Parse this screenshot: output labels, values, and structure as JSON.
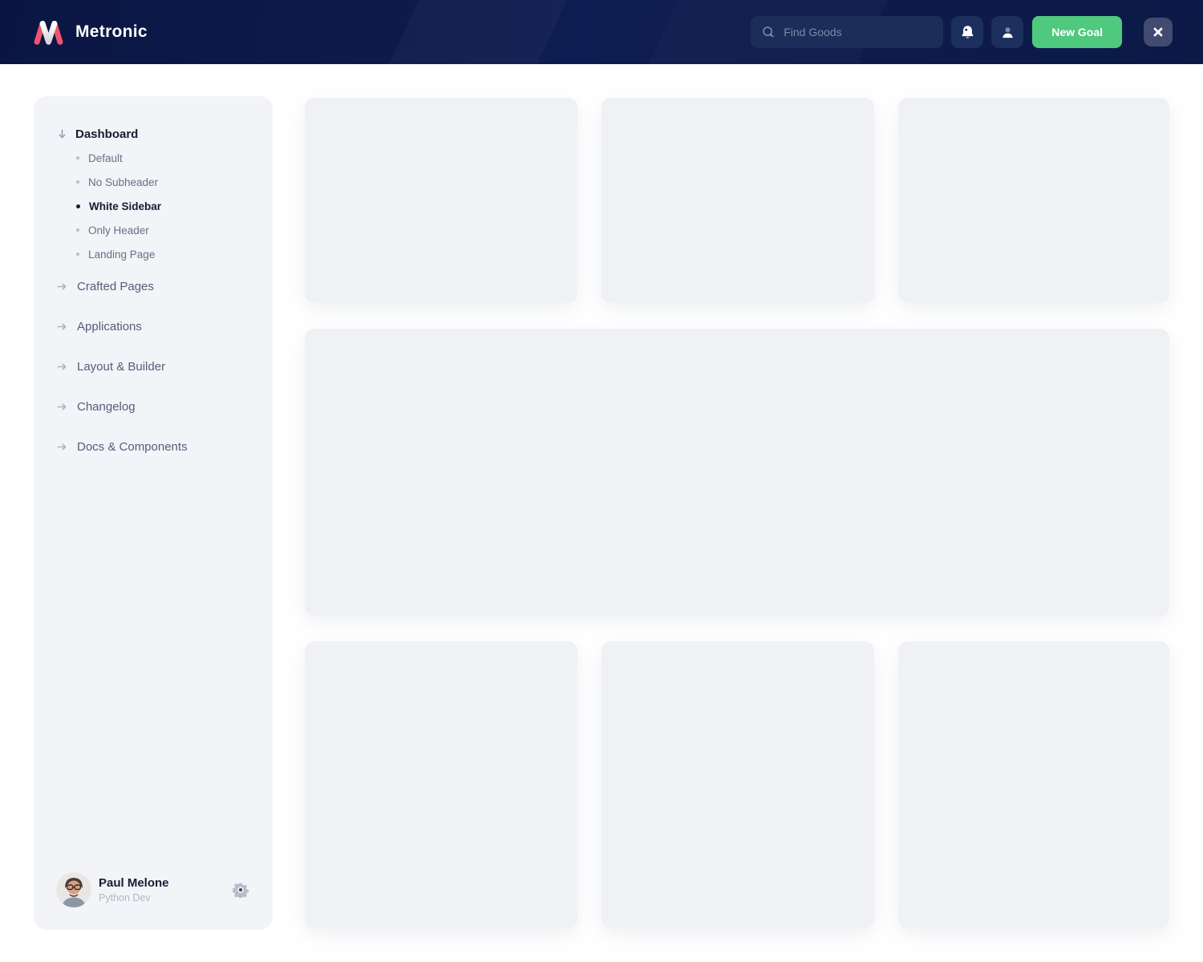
{
  "header": {
    "brand": "Metronic",
    "logo_icon": "metronic-m-logo",
    "search": {
      "placeholder": "Find Goods",
      "icon": "search-icon"
    },
    "actions": {
      "notifications_icon": "bell-icon",
      "profile_icon": "user-icon",
      "new_goal_label": "New Goal",
      "close_icon": "close-icon"
    }
  },
  "sidebar": {
    "sections": [
      {
        "label": "Dashboard",
        "icon": "arrow-down-icon",
        "expanded": true,
        "children": [
          {
            "label": "Default",
            "active": false
          },
          {
            "label": "No Subheader",
            "active": false
          },
          {
            "label": "White Sidebar",
            "active": true
          },
          {
            "label": "Only Header",
            "active": false
          },
          {
            "label": "Landing Page",
            "active": false
          }
        ]
      },
      {
        "label": "Crafted Pages",
        "icon": "arrow-right-icon"
      },
      {
        "label": "Applications",
        "icon": "arrow-right-icon"
      },
      {
        "label": "Layout & Builder",
        "icon": "arrow-right-icon"
      },
      {
        "label": "Changelog",
        "icon": "arrow-right-icon"
      },
      {
        "label": "Docs & Components",
        "icon": "arrow-right-icon"
      }
    ],
    "user": {
      "name": "Paul Melone",
      "role": "Python Dev",
      "settings_icon": "gear-icon"
    }
  },
  "main": {
    "placeholder_cards": 7,
    "layout": "3 cards top row, 1 wide card middle, 3 cards bottom row"
  },
  "colors": {
    "header_bg": "#0d1b4d",
    "brand_red": "#f1536e",
    "accent_green": "#4ec97d",
    "sidebar_bg": "#f3f4f8",
    "card_bg": "#f0f1f4",
    "text_dark": "#181c32",
    "text_muted": "#6a6e85",
    "text_faint": "#b5b5c3"
  }
}
